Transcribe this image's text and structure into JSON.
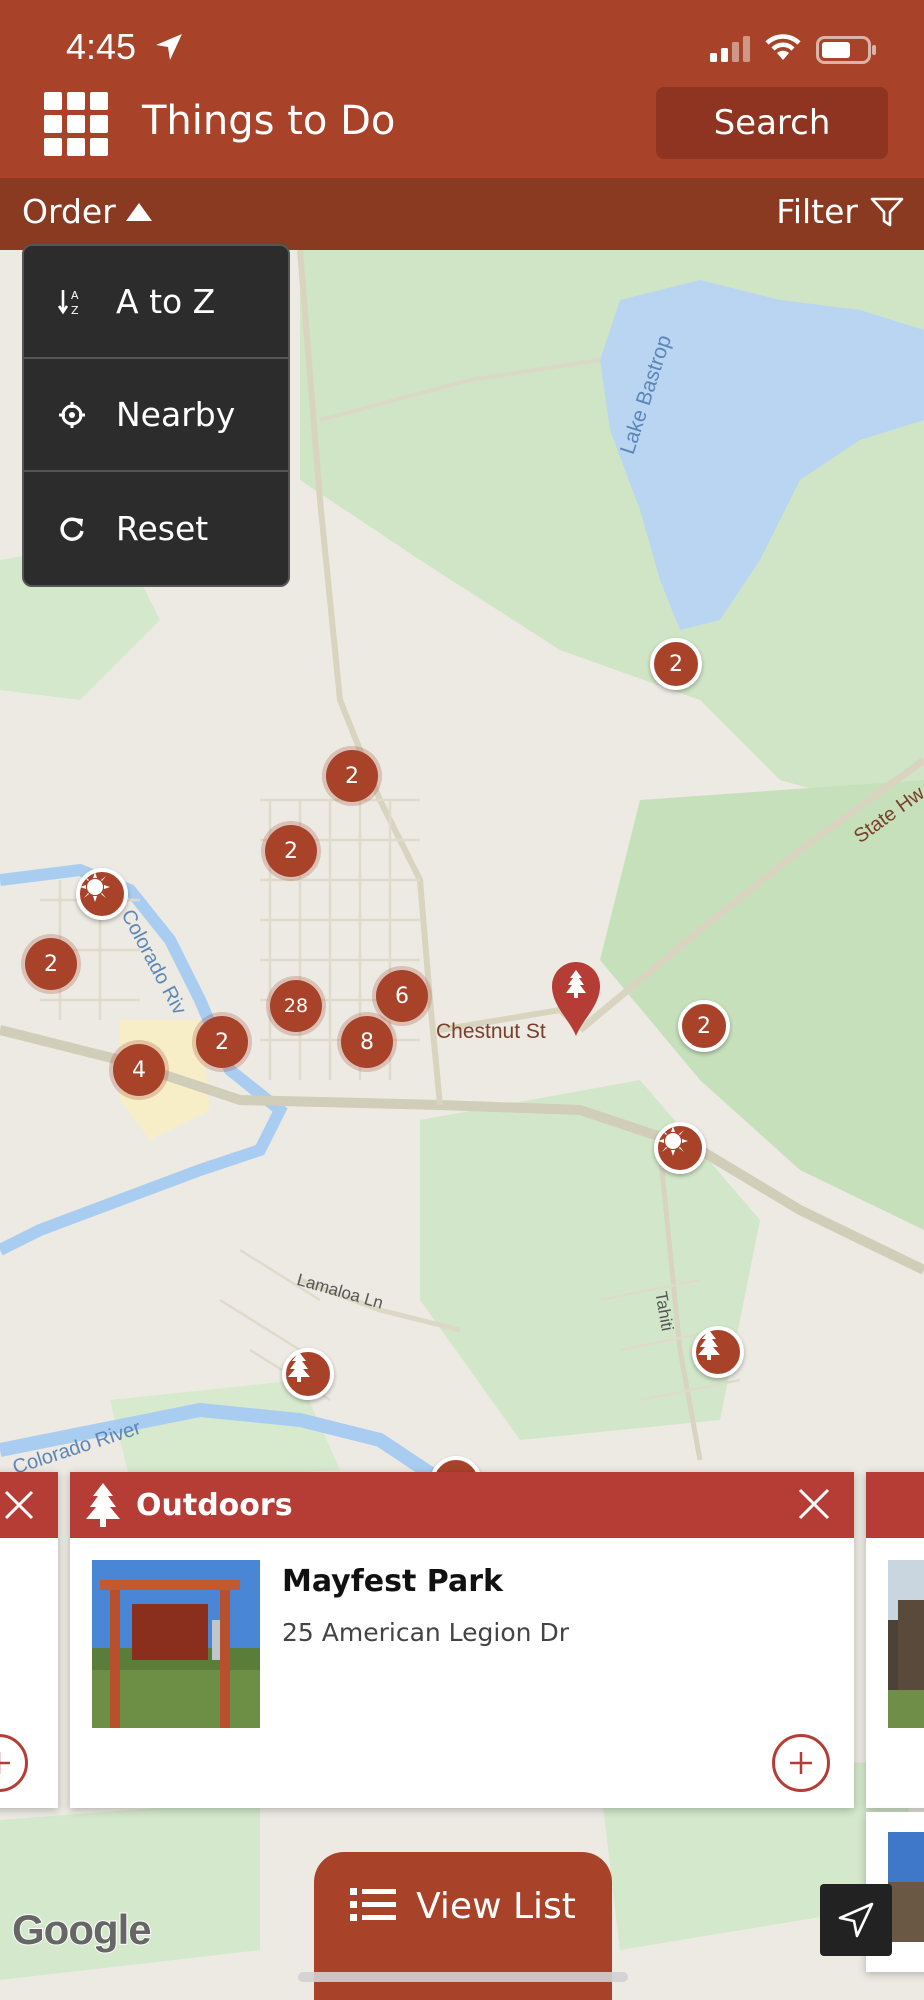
{
  "status_bar": {
    "time": "4:45"
  },
  "header": {
    "title": "Things to Do",
    "search_label": "Search"
  },
  "subbar": {
    "order_label": "Order",
    "filter_label": "Filter"
  },
  "order_menu": {
    "items": [
      {
        "label": "A to Z",
        "icon": "sort-alpha-icon"
      },
      {
        "label": "Nearby",
        "icon": "crosshair-icon"
      },
      {
        "label": "Reset",
        "icon": "reset-icon"
      }
    ]
  },
  "map": {
    "labels": {
      "lake": "Lake Bastrop",
      "river1": "Colorado Riv",
      "river2": "Colorado River",
      "chestnut": "Chestnut St",
      "lamaloa": "Lamaloa Ln",
      "tahiti": "Tahiti",
      "state_hwy": "State Hw"
    },
    "clusters": [
      "2",
      "2",
      "2",
      "2",
      "28",
      "6",
      "2",
      "8",
      "4",
      "2"
    ],
    "attribution": "Google"
  },
  "card": {
    "category": "Outdoors",
    "name": "Mayfest Park",
    "address": "25 American Legion Dr"
  },
  "bottom": {
    "view_list_label": "View List"
  },
  "colors": {
    "brand": "#a8432a",
    "card_header": "#b53d36",
    "menu_bg": "#2c2c2c"
  }
}
